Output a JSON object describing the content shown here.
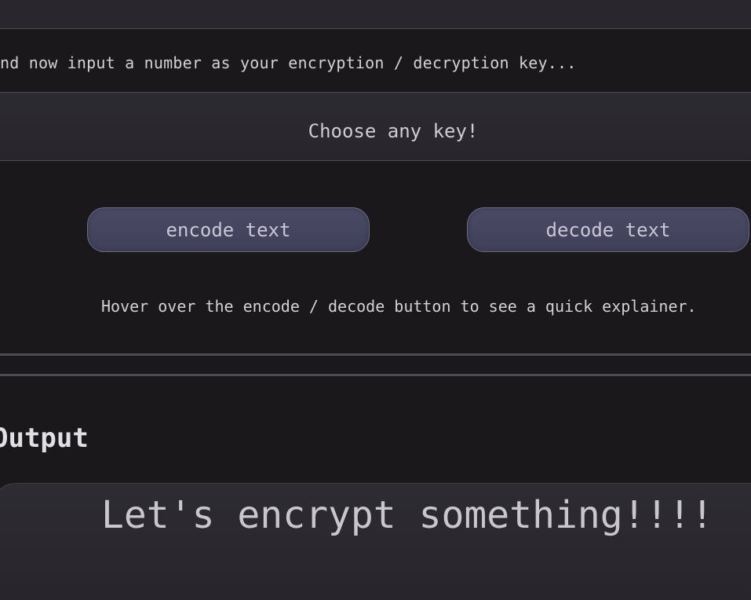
{
  "key_section": {
    "prompt": "nd now input a number as your encryption / decryption key...",
    "placeholder": "Choose any key!"
  },
  "actions": {
    "encode_label": "encode text",
    "decode_label": "decode text",
    "hint": "Hover over the encode / decode button to see a quick explainer."
  },
  "output": {
    "heading": "Output",
    "text": "Let's encrypt something!!!!"
  },
  "colors": {
    "background": "#1a181b",
    "button": "#45445f",
    "text": "#d4d1d6"
  }
}
